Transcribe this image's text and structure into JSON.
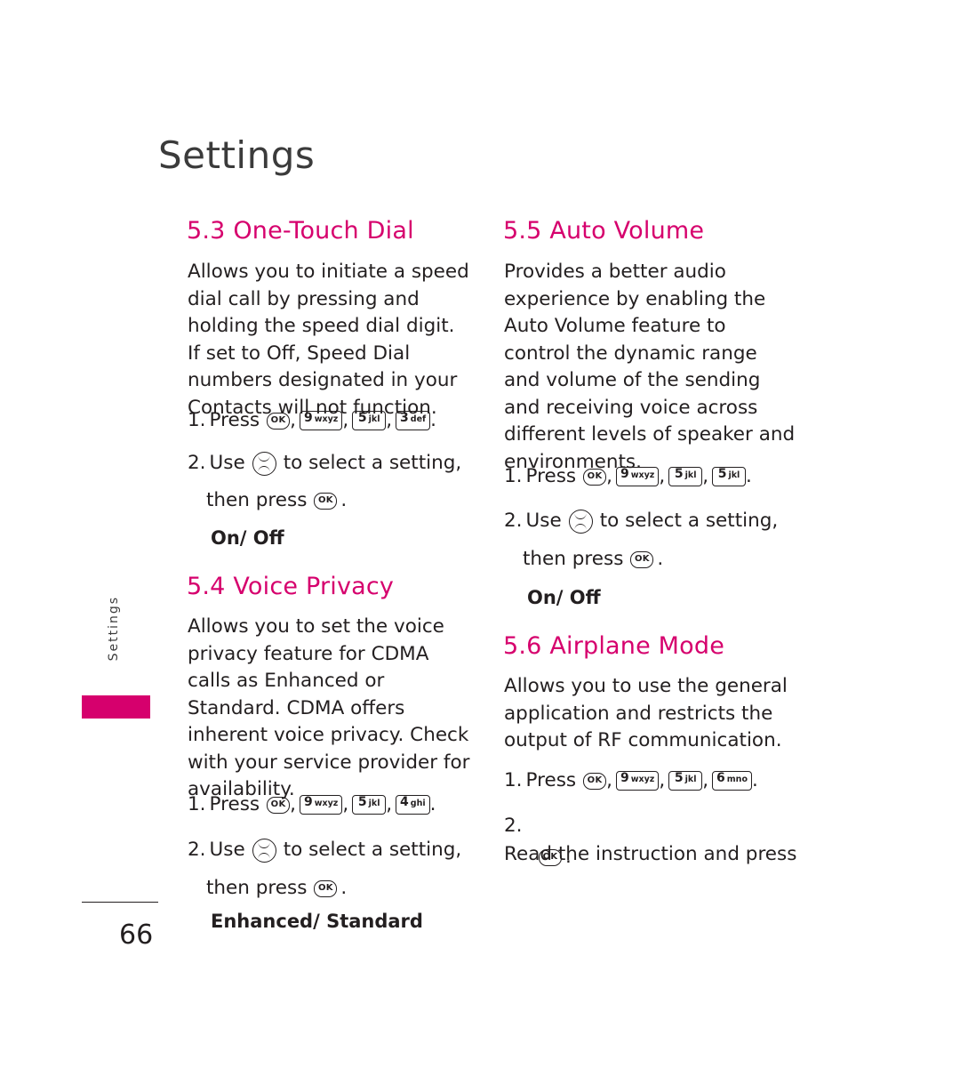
{
  "page": {
    "title": "Settings",
    "side_tab": "Settings",
    "number": "66"
  },
  "sections": [
    {
      "id": "one-touch-dial",
      "heading": "5.3 One-Touch Dial",
      "body": "Allows you to initiate a speed dial call by pressing and holding the speed dial digit. If set to Off, Speed Dial numbers designated in your Contacts will not function.",
      "steps": [
        {
          "number": "1.",
          "verb": "Press",
          "keys": [
            "OK",
            "9 wxyz",
            "5 jkl",
            "3 def"
          ],
          "tail": "."
        },
        {
          "number": "2.",
          "verb": "Use",
          "mid": "to select a setting,",
          "then": "then press",
          "tail": "."
        }
      ],
      "options": "On/ Off"
    },
    {
      "id": "voice-privacy",
      "heading": "5.4 Voice Privacy",
      "body": "Allows you to set the voice privacy feature for CDMA calls as Enhanced or Standard. CDMA offers inherent voice privacy. Check with your service provider for availability.",
      "steps": [
        {
          "number": "1.",
          "verb": "Press",
          "keys": [
            "OK",
            "9 wxyz",
            "5 jkl",
            "4 ghi"
          ],
          "tail": "."
        },
        {
          "number": "2.",
          "verb": "Use",
          "mid": "to select a setting,",
          "then": "then press",
          "tail": "."
        }
      ],
      "options": "Enhanced/ Standard"
    },
    {
      "id": "auto-volume",
      "heading": "5.5 Auto Volume",
      "body": "Provides a better audio experience by enabling the Auto Volume feature to control the dynamic range and volume of the sending and receiving voice across different levels of speaker and environments.",
      "steps": [
        {
          "number": "1.",
          "verb": "Press",
          "keys": [
            "OK",
            "9 wxyz",
            "5 jkl",
            "5 jkl"
          ],
          "tail": "."
        },
        {
          "number": "2.",
          "verb": "Use",
          "mid": "to select a setting,",
          "then": "then press",
          "tail": "."
        }
      ],
      "options": "On/ Off"
    },
    {
      "id": "airplane-mode",
      "heading": "5.6 Airplane Mode",
      "body": "Allows you to use the general application and restricts the output of RF communication.",
      "steps": [
        {
          "number": "1.",
          "verb": "Press",
          "keys": [
            "OK",
            "9 wxyz",
            "5 jkl",
            "6 mno"
          ],
          "tail": "."
        },
        {
          "number": "2.",
          "text": "Read the instruction and press",
          "tail": "."
        }
      ],
      "options": ""
    }
  ],
  "keys": {
    "ok": "OK",
    "nine": {
      "digit": "9",
      "letters": "wxyz"
    },
    "five": {
      "digit": "5",
      "letters": "jkl"
    },
    "three": {
      "digit": "3",
      "letters": "def"
    },
    "four": {
      "digit": "4",
      "letters": "ghi"
    },
    "six": {
      "digit": "6",
      "letters": "mno"
    }
  },
  "colors": {
    "accent": "#d6006d",
    "text": "#231f20",
    "title": "#3b3b3b"
  }
}
